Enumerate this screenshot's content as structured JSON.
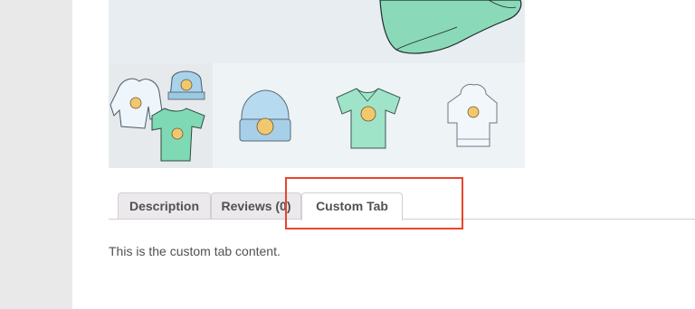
{
  "tabs": {
    "description_label": "Description",
    "reviews_label": "Reviews (0)",
    "custom_label": "Custom Tab",
    "active": "Custom Tab"
  },
  "tab_panel": {
    "content": "This is the custom tab content."
  },
  "gallery": {
    "thumbnails": [
      "hoodie-beanie-tshirt-set",
      "beanie",
      "v-neck-tshirt",
      "hoodie"
    ]
  },
  "colors": {
    "highlight": "#e8452c",
    "mint": "#7fd9b4",
    "light-blue": "#a9d3ea"
  }
}
